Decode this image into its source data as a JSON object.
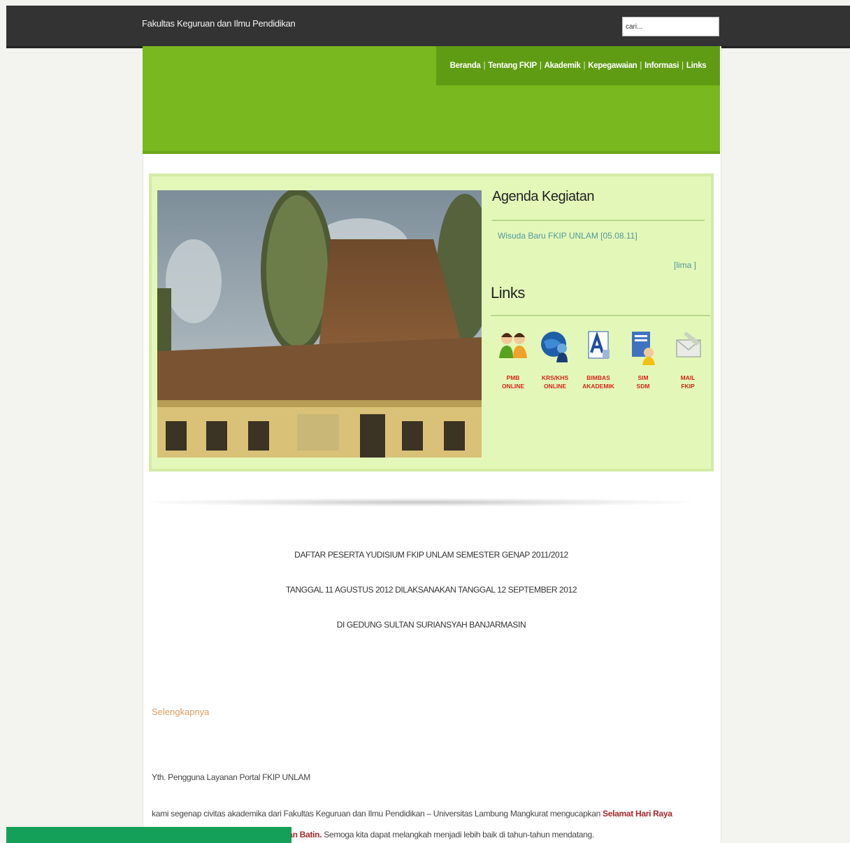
{
  "site": {
    "title": "Fakultas Keguruan dan Ilmu Pendidikan"
  },
  "search": {
    "value": "cari..."
  },
  "nav": {
    "items": [
      "Beranda",
      "Tentang FKIP",
      "Akademik",
      "Kepegawaian",
      "Informasi",
      "Links"
    ],
    "separator": "|"
  },
  "agenda": {
    "title": "Agenda Kegiatan",
    "items": [
      "Wisuda Baru FKIP UNLAM [05.08.11]"
    ],
    "more_label": "[lima ]"
  },
  "links": {
    "title": "Links",
    "items": [
      {
        "label": "PMB\nONLINE",
        "icon": "students-icon"
      },
      {
        "label": "KRS/KHS\nONLINE",
        "icon": "globe-person-icon"
      },
      {
        "label": "BIMBAS\nAKADEMIK",
        "icon": "academic-document-icon"
      },
      {
        "label": "SIM\nSDM",
        "icon": "staff-document-icon"
      },
      {
        "label": "MAIL\nFKIP",
        "icon": "envelope-icon"
      }
    ]
  },
  "article": {
    "heading_lines": [
      "DAFTAR PESERTA YUDISIUM FKIP UNLAM SEMESTER GENAP 2011/2012",
      "TANGGAL 11 AGUSTUS 2012 DILAKSANAKAN TANGGAL 12 SEPTEMBER 2012",
      "DI GEDUNG SULTAN SURIANSYAH BANJARMASIN"
    ],
    "greeting": "Selengkapnya",
    "salutation": "Yth. Pengguna Layanan Portal FKIP UNLAM",
    "body_intro": "kami segenap civitas akademika dari Fakultas Keguruan dan Ilmu Pendidikan – Universitas Lambung Mangkurat mengucapkan",
    "body_highlight": "Selamat Hari Raya",
    "body_cont_highlight": "Idul Fitri 1433 H Mohon Maaf Lahir dan Batin.",
    "body_cont": "Semoga kita dapat melangkah menjadi lebih baik di tahun-tahun mendatang."
  },
  "colors": {
    "topbar": "#333333",
    "header_green": "#79b81e",
    "nav_green": "#5f9c14",
    "panel_green": "#e3f8b8",
    "link_red": "#d7251a",
    "bottom_bar": "#15a05a"
  }
}
